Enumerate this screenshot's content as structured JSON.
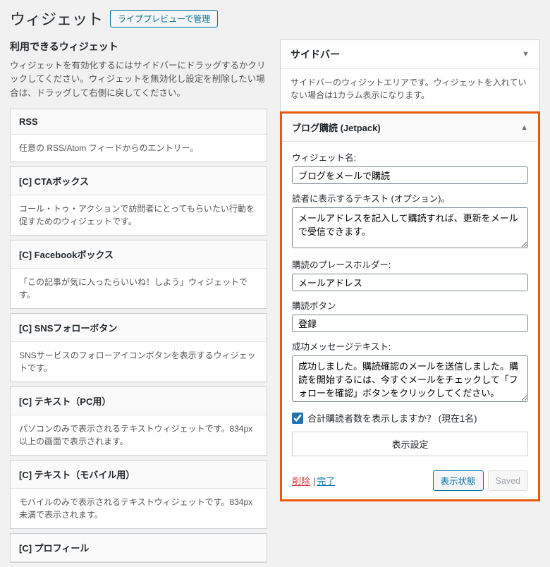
{
  "header": {
    "title": "ウィジェット",
    "manage_link": "ライブプレビューで管理"
  },
  "available": {
    "heading": "利用できるウィジェット",
    "description": "ウィジェットを有効化するにはサイドバーにドラッグするかクリックしてください。ウィジェットを無効化し設定を削除したい場合は、ドラッグして右側に戻してください。",
    "items": [
      {
        "title": "RSS",
        "desc": "任意の RSS/Atom フィードからのエントリー。"
      },
      {
        "title": "[C] CTAボックス",
        "desc": "コール・トゥ・アクションで訪問者にとってもらいたい行動を促すためのウィジェットです。"
      },
      {
        "title": "[C] Facebookボックス",
        "desc": "「この記事が気に入ったらいいね！しよう」ウィジェットです。"
      },
      {
        "title": "[C] SNSフォローボタン",
        "desc": "SNSサービスのフォローアイコンボタンを表示するウィジェットです。"
      },
      {
        "title": "[C] テキスト（PC用）",
        "desc": "パソコンのみで表示されるテキストウィジェットです。834px以上の画面で表示されます。"
      },
      {
        "title": "[C] テキスト（モバイル用）",
        "desc": "モバイルのみで表示されるテキストウィジェットです。834px未満で表示されます。"
      },
      {
        "title": "[C] プロフィール",
        "desc": ""
      }
    ]
  },
  "sidebar": {
    "title": "サイドバー",
    "description": "サイドバーのウィジットエリアです。ウィジェットを入れていない場合は1カラム表示になります。"
  },
  "editor": {
    "title": "ブログ購読 (Jetpack)",
    "fields": {
      "widget_name_label": "ウィジェット名:",
      "widget_name_value": "ブログをメールで購読",
      "reader_text_label": "読者に表示するテキスト (オプション)。",
      "reader_text_value": "メールアドレスを記入して購読すれば、更新をメールで受信できます。",
      "placeholder_label": "購読のプレースホルダー:",
      "placeholder_value": "メールアドレス",
      "button_label": "購読ボタン",
      "button_value": "登録",
      "success_label": "成功メッセージテキスト:",
      "success_value": "成功しました。購読確認のメールを送信しました。購読を開始するには、今すぐメールをチェックして「フォローを確認」ボタンをクリックしてください。",
      "show_count_label": "合計購読者数を表示しますか？ (現在1名)"
    },
    "display_settings": "表示設定",
    "footer": {
      "delete": "削除",
      "done": "完了",
      "visibility": "表示状態",
      "saved": "Saved"
    }
  }
}
